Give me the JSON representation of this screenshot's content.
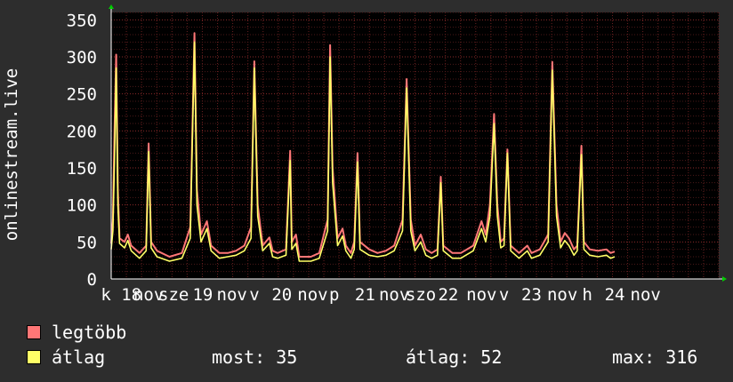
{
  "chart_data": {
    "type": "line",
    "ylabel": "onlinestream.live",
    "ylim": [
      0,
      360
    ],
    "yticks": [
      0,
      50,
      100,
      150,
      200,
      250,
      300,
      350
    ],
    "xlim": [
      0,
      7.3
    ],
    "xticks": [
      {
        "x": 0.12,
        "label": "k 18"
      },
      {
        "x": 0.45,
        "label": "nov"
      },
      {
        "x": 0.75,
        "label": "sze"
      },
      {
        "x": 1.1,
        "label": "19"
      },
      {
        "x": 1.45,
        "label": "nov"
      },
      {
        "x": 1.72,
        "label": "v"
      },
      {
        "x": 2.05,
        "label": "20"
      },
      {
        "x": 2.42,
        "label": "nov"
      },
      {
        "x": 2.68,
        "label": "p"
      },
      {
        "x": 3.05,
        "label": "21"
      },
      {
        "x": 3.4,
        "label": "nov"
      },
      {
        "x": 3.72,
        "label": "szo"
      },
      {
        "x": 4.05,
        "label": "22"
      },
      {
        "x": 4.45,
        "label": "nov"
      },
      {
        "x": 4.72,
        "label": "v"
      },
      {
        "x": 5.05,
        "label": "23"
      },
      {
        "x": 5.42,
        "label": "nov"
      },
      {
        "x": 5.72,
        "label": "h"
      },
      {
        "x": 6.05,
        "label": "24"
      },
      {
        "x": 6.42,
        "label": "nov"
      }
    ],
    "grid": true,
    "series": [
      {
        "name": "legtöbb",
        "color": "#ff7777",
        "points": [
          [
            0,
            48
          ],
          [
            0.02,
            80
          ],
          [
            0.04,
            200
          ],
          [
            0.06,
            303
          ],
          [
            0.08,
            120
          ],
          [
            0.1,
            55
          ],
          [
            0.16,
            50
          ],
          [
            0.2,
            60
          ],
          [
            0.24,
            45
          ],
          [
            0.34,
            35
          ],
          [
            0.42,
            45
          ],
          [
            0.45,
            183
          ],
          [
            0.48,
            50
          ],
          [
            0.55,
            38
          ],
          [
            0.7,
            30
          ],
          [
            0.85,
            35
          ],
          [
            0.95,
            70
          ],
          [
            1.0,
            332
          ],
          [
            1.03,
            120
          ],
          [
            1.08,
            60
          ],
          [
            1.15,
            78
          ],
          [
            1.2,
            45
          ],
          [
            1.3,
            35
          ],
          [
            1.4,
            35
          ],
          [
            1.5,
            38
          ],
          [
            1.6,
            45
          ],
          [
            1.68,
            70
          ],
          [
            1.72,
            294
          ],
          [
            1.76,
            100
          ],
          [
            1.82,
            45
          ],
          [
            1.9,
            56
          ],
          [
            1.94,
            38
          ],
          [
            2.0,
            35
          ],
          [
            2.1,
            40
          ],
          [
            2.15,
            173
          ],
          [
            2.17,
            50
          ],
          [
            2.22,
            60
          ],
          [
            2.26,
            30
          ],
          [
            2.4,
            30
          ],
          [
            2.5,
            35
          ],
          [
            2.6,
            80
          ],
          [
            2.63,
            316
          ],
          [
            2.66,
            150
          ],
          [
            2.72,
            55
          ],
          [
            2.78,
            68
          ],
          [
            2.82,
            45
          ],
          [
            2.88,
            35
          ],
          [
            2.92,
            50
          ],
          [
            2.96,
            170
          ],
          [
            2.99,
            50
          ],
          [
            3.1,
            40
          ],
          [
            3.2,
            35
          ],
          [
            3.3,
            38
          ],
          [
            3.4,
            45
          ],
          [
            3.5,
            80
          ],
          [
            3.55,
            270
          ],
          [
            3.6,
            80
          ],
          [
            3.65,
            45
          ],
          [
            3.72,
            60
          ],
          [
            3.78,
            40
          ],
          [
            3.85,
            35
          ],
          [
            3.92,
            40
          ],
          [
            3.96,
            138
          ],
          [
            3.99,
            45
          ],
          [
            4.1,
            35
          ],
          [
            4.2,
            35
          ],
          [
            4.35,
            45
          ],
          [
            4.45,
            78
          ],
          [
            4.5,
            60
          ],
          [
            4.55,
            100
          ],
          [
            4.6,
            223
          ],
          [
            4.64,
            100
          ],
          [
            4.68,
            50
          ],
          [
            4.72,
            55
          ],
          [
            4.76,
            175
          ],
          [
            4.8,
            45
          ],
          [
            4.9,
            35
          ],
          [
            5.0,
            45
          ],
          [
            5.05,
            35
          ],
          [
            5.15,
            40
          ],
          [
            5.25,
            60
          ],
          [
            5.3,
            293
          ],
          [
            5.35,
            100
          ],
          [
            5.4,
            50
          ],
          [
            5.45,
            62
          ],
          [
            5.5,
            55
          ],
          [
            5.56,
            40
          ],
          [
            5.6,
            45
          ],
          [
            5.65,
            180
          ],
          [
            5.68,
            50
          ],
          [
            5.75,
            40
          ],
          [
            5.85,
            38
          ],
          [
            5.95,
            40
          ],
          [
            6.0,
            35
          ],
          [
            6.05,
            37
          ]
        ]
      },
      {
        "name": "átlag",
        "color": "#ffff66",
        "points": [
          [
            0,
            40
          ],
          [
            0.02,
            65
          ],
          [
            0.04,
            160
          ],
          [
            0.06,
            285
          ],
          [
            0.08,
            100
          ],
          [
            0.1,
            48
          ],
          [
            0.16,
            42
          ],
          [
            0.2,
            52
          ],
          [
            0.24,
            38
          ],
          [
            0.34,
            28
          ],
          [
            0.42,
            38
          ],
          [
            0.45,
            172
          ],
          [
            0.48,
            42
          ],
          [
            0.55,
            30
          ],
          [
            0.7,
            24
          ],
          [
            0.85,
            28
          ],
          [
            0.95,
            55
          ],
          [
            1.0,
            320
          ],
          [
            1.03,
            100
          ],
          [
            1.08,
            50
          ],
          [
            1.15,
            68
          ],
          [
            1.2,
            38
          ],
          [
            1.3,
            28
          ],
          [
            1.4,
            30
          ],
          [
            1.5,
            32
          ],
          [
            1.6,
            38
          ],
          [
            1.68,
            55
          ],
          [
            1.72,
            285
          ],
          [
            1.76,
            85
          ],
          [
            1.82,
            38
          ],
          [
            1.9,
            48
          ],
          [
            1.94,
            30
          ],
          [
            2.0,
            28
          ],
          [
            2.1,
            32
          ],
          [
            2.15,
            160
          ],
          [
            2.17,
            40
          ],
          [
            2.22,
            48
          ],
          [
            2.26,
            24
          ],
          [
            2.4,
            24
          ],
          [
            2.5,
            28
          ],
          [
            2.6,
            65
          ],
          [
            2.63,
            300
          ],
          [
            2.66,
            130
          ],
          [
            2.72,
            45
          ],
          [
            2.78,
            58
          ],
          [
            2.82,
            38
          ],
          [
            2.88,
            28
          ],
          [
            2.92,
            40
          ],
          [
            2.96,
            158
          ],
          [
            2.99,
            40
          ],
          [
            3.1,
            32
          ],
          [
            3.2,
            30
          ],
          [
            3.3,
            32
          ],
          [
            3.4,
            38
          ],
          [
            3.5,
            65
          ],
          [
            3.55,
            258
          ],
          [
            3.6,
            65
          ],
          [
            3.65,
            38
          ],
          [
            3.72,
            50
          ],
          [
            3.78,
            32
          ],
          [
            3.85,
            28
          ],
          [
            3.92,
            32
          ],
          [
            3.96,
            130
          ],
          [
            3.99,
            38
          ],
          [
            4.1,
            28
          ],
          [
            4.2,
            28
          ],
          [
            4.35,
            38
          ],
          [
            4.45,
            68
          ],
          [
            4.5,
            50
          ],
          [
            4.55,
            85
          ],
          [
            4.6,
            210
          ],
          [
            4.64,
            85
          ],
          [
            4.68,
            42
          ],
          [
            4.72,
            45
          ],
          [
            4.76,
            170
          ],
          [
            4.8,
            38
          ],
          [
            4.9,
            28
          ],
          [
            5.0,
            38
          ],
          [
            5.05,
            28
          ],
          [
            5.15,
            32
          ],
          [
            5.25,
            50
          ],
          [
            5.3,
            282
          ],
          [
            5.35,
            85
          ],
          [
            5.4,
            42
          ],
          [
            5.45,
            52
          ],
          [
            5.5,
            45
          ],
          [
            5.56,
            32
          ],
          [
            5.6,
            38
          ],
          [
            5.65,
            168
          ],
          [
            5.68,
            40
          ],
          [
            5.75,
            32
          ],
          [
            5.85,
            30
          ],
          [
            5.95,
            32
          ],
          [
            6.0,
            28
          ],
          [
            6.05,
            30
          ]
        ]
      }
    ]
  },
  "legend": [
    {
      "label": "legtöbb",
      "color": "#ff7777"
    },
    {
      "label": "átlag",
      "color": "#ffff66"
    }
  ],
  "stats": {
    "current": "most: 35",
    "average": "átlag: 52",
    "max": "max: 316"
  }
}
